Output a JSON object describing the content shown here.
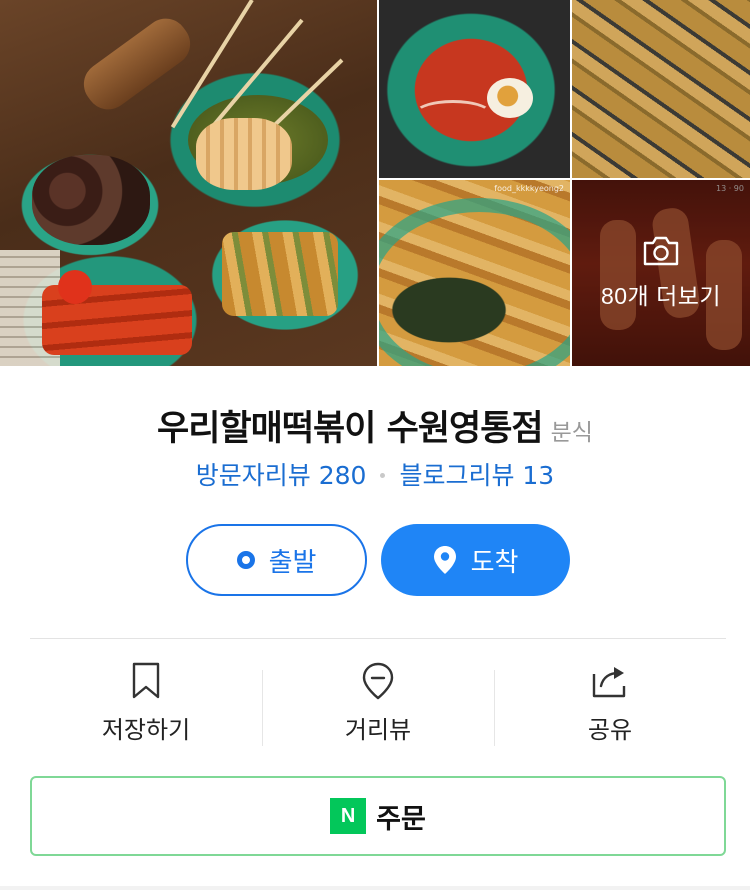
{
  "gallery": {
    "photos": [
      {
        "name": "main-photo"
      },
      {
        "name": "tteokbokki-photo"
      },
      {
        "name": "fried-photo"
      },
      {
        "name": "twigim-photo",
        "watermark": "food_kkkkyeong2"
      },
      {
        "name": "more-photo",
        "watermark": "13 · 90"
      }
    ],
    "more_label": "80개 더보기",
    "more_icon": "camera-icon"
  },
  "place": {
    "name": "우리할매떡볶이 수원영통점",
    "category": "분식",
    "visitor_review": "방문자리뷰 280",
    "blog_review": "블로그리뷰 13"
  },
  "directions": {
    "depart_label": "출발",
    "arrive_label": "도착",
    "depart_icon": "origin-dot-icon",
    "arrive_icon": "location-pin-icon"
  },
  "actions": [
    {
      "label": "저장하기",
      "icon": "bookmark-icon"
    },
    {
      "label": "거리뷰",
      "icon": "streetview-pin-icon"
    },
    {
      "label": "공유",
      "icon": "share-icon"
    }
  ],
  "order": {
    "badge": "N",
    "label": "주문"
  },
  "colors": {
    "accent_blue": "#1f85f6",
    "link_blue": "#1a6dd1",
    "naver_green": "#03c75a",
    "order_border": "#7fd896"
  }
}
